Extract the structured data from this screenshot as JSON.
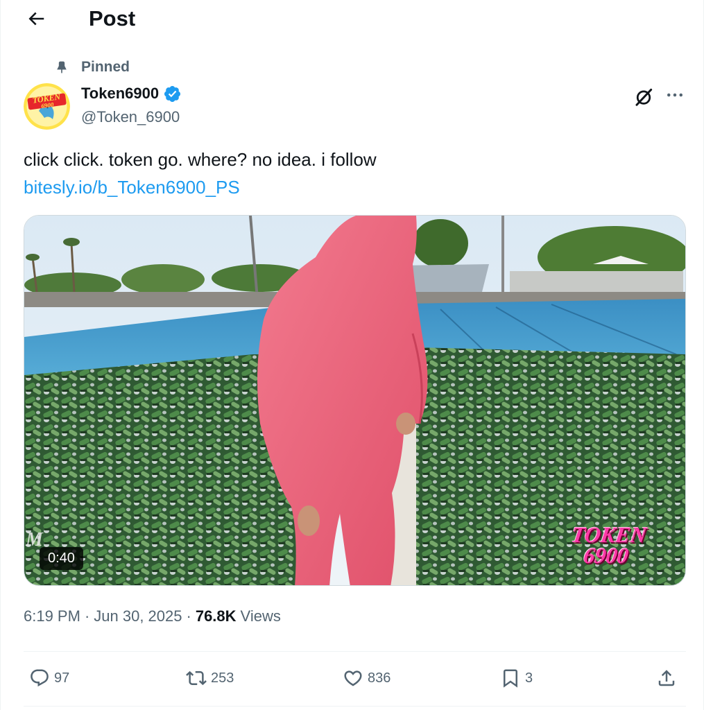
{
  "header": {
    "title": "Post"
  },
  "post": {
    "pinned_label": "Pinned",
    "author": {
      "display_name": "Token6900",
      "handle": "@Token_6900",
      "avatar_text_top": "TOKEN",
      "avatar_text_bottom": "6900",
      "verified": true
    },
    "text": "click click. token go. where? no idea. i follow",
    "link": "bitesly.io/b_Token6900_PS",
    "media": {
      "duration": "0:40",
      "watermark_line1": "TOKEN",
      "watermark_line2": "6900"
    },
    "meta": {
      "time": "6:19 PM",
      "separator": "·",
      "date": "Jun 30, 2025",
      "views_count": "76.8K",
      "views_label": "Views"
    },
    "actions": {
      "replies": "97",
      "reposts": "253",
      "likes": "836",
      "bookmarks": "3"
    }
  },
  "colors": {
    "accent": "#1d9bf0",
    "secondary_text": "#536471",
    "primary_text": "#0f1419"
  }
}
